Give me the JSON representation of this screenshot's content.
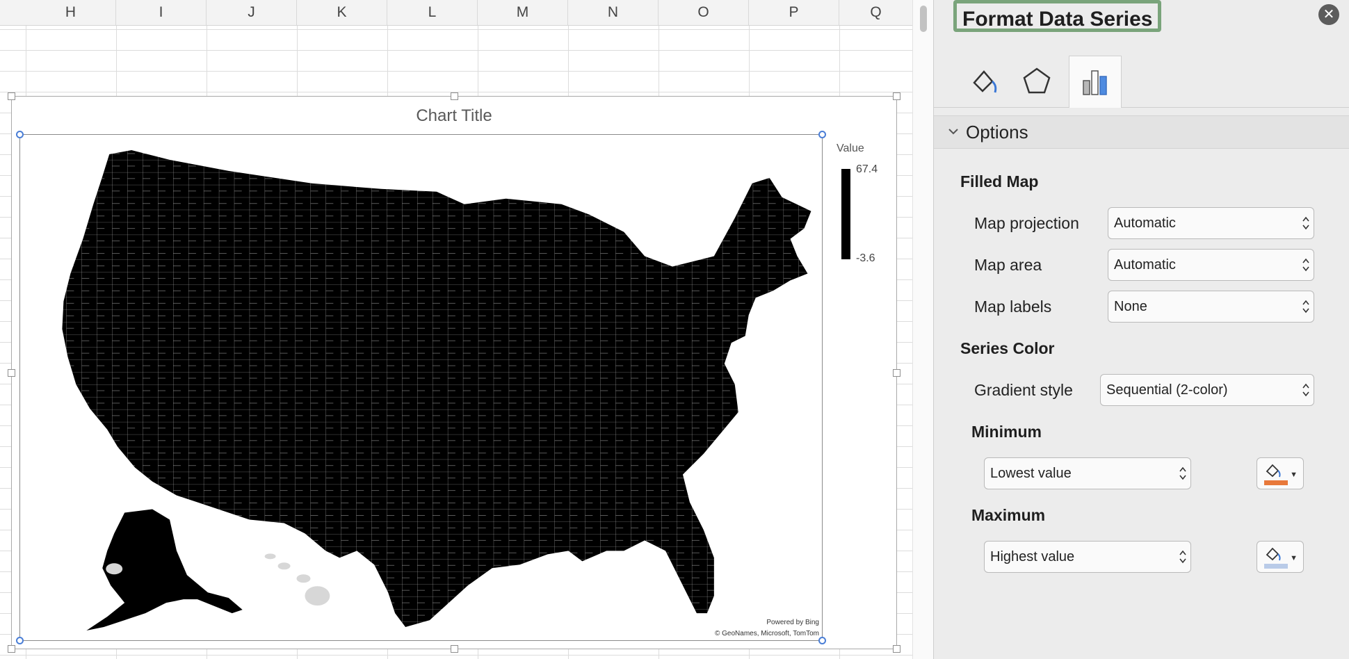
{
  "sheet": {
    "columns": [
      "H",
      "I",
      "J",
      "K",
      "L",
      "M",
      "N",
      "O",
      "P",
      "Q"
    ]
  },
  "chart": {
    "title": "Chart Title",
    "legend": {
      "title": "Value",
      "max": "67.4",
      "min": "-3.6"
    },
    "attribution_1": "Powered by Bing",
    "attribution_2": "© GeoNames, Microsoft, TomTom",
    "map_color": "#000000"
  },
  "pane": {
    "title": "Format Data Series",
    "tabs": [
      {
        "icon": "paint-bucket-icon"
      },
      {
        "icon": "pentagon-icon"
      },
      {
        "icon": "bar-chart-icon"
      }
    ],
    "options_label": "Options",
    "filled_map": {
      "heading": "Filled Map",
      "projection_label": "Map projection",
      "projection_value": "Automatic",
      "area_label": "Map area",
      "area_value": "Automatic",
      "labels_label": "Map labels",
      "labels_value": "None"
    },
    "series_color": {
      "heading": "Series Color",
      "gradient_label": "Gradient style",
      "gradient_value": "Sequential (2-color)",
      "minimum_heading": "Minimum",
      "minimum_value": "Lowest value",
      "minimum_color": "#e8793b",
      "maximum_heading": "Maximum",
      "maximum_value": "Highest value",
      "maximum_color": "#b9cbe8"
    },
    "accent_color": "#7aa47b"
  }
}
